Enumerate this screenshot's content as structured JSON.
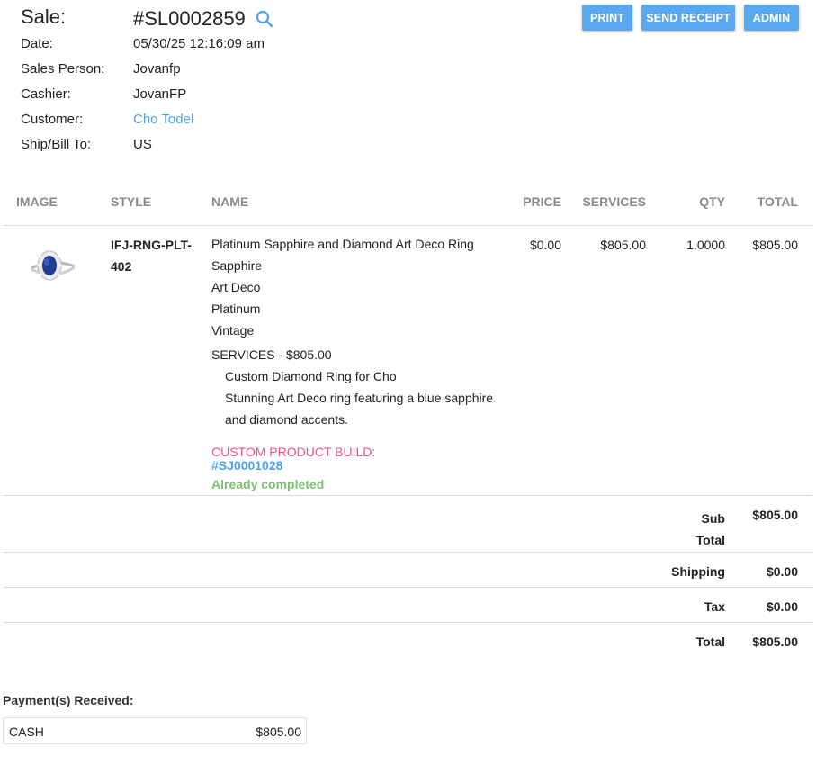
{
  "header": {
    "sale_label": "Sale:",
    "sale_number": "#SL0002859",
    "fields": [
      {
        "label": "Date:",
        "value": "05/30/25 12:16:09 am"
      },
      {
        "label": "Sales Person:",
        "value": "Jovanfp"
      },
      {
        "label": "Cashier:",
        "value": "JovanFP"
      },
      {
        "label": "Customer:",
        "value": "Cho Todel"
      },
      {
        "label": "Ship/Bill To:",
        "value": "US"
      }
    ]
  },
  "actions": {
    "print": "PRINT",
    "send_receipt": "SEND RECEIPT",
    "admin": "ADMIN"
  },
  "table": {
    "headers": {
      "image": "IMAGE",
      "style": "STYLE",
      "name": "NAME",
      "price": "PRICE",
      "services": "SERVICES",
      "qty": "QTY",
      "total": "TOTAL"
    },
    "item": {
      "style_line1": "IFJ-RNG-PLT-",
      "style_line2": "402",
      "name": "Platinum Sapphire and Diamond Art Deco Ring",
      "attributes": [
        "Sapphire",
        "Art Deco",
        "Platinum",
        "Vintage"
      ],
      "services_heading": "SERVICES - $805.00",
      "service_lines": [
        "Custom Diamond Ring for Cho",
        "Stunning Art Deco ring featuring a blue sapphire",
        "and diamond accents."
      ],
      "custom_build_label": "CUSTOM PRODUCT BUILD:",
      "custom_build_number": "#SJ0001028",
      "build_status": "Already completed",
      "price": "$0.00",
      "services": "$805.00",
      "qty": "1.0000",
      "total": "$805.00"
    }
  },
  "totals": {
    "sub_label_1": "Sub",
    "sub_label_2": "Total",
    "sub_value": "$805.00",
    "shipping_label": "Shipping",
    "shipping_value": "$0.00",
    "tax_label": "Tax",
    "tax_value": "$0.00",
    "total_label": "Total",
    "total_value": "$805.00"
  },
  "payments": {
    "title": "Payment(s) Received:",
    "items": [
      {
        "method": "CASH",
        "amount": "$805.00"
      }
    ]
  },
  "colors": {
    "accent": "#5aa9f0",
    "link": "#4aa3ef",
    "custom_build": "#f0508c",
    "completed": "#7cc16f",
    "header_text": "#8a8a8a"
  },
  "icons": {
    "search": "search-icon",
    "product": "ring-product-image"
  }
}
